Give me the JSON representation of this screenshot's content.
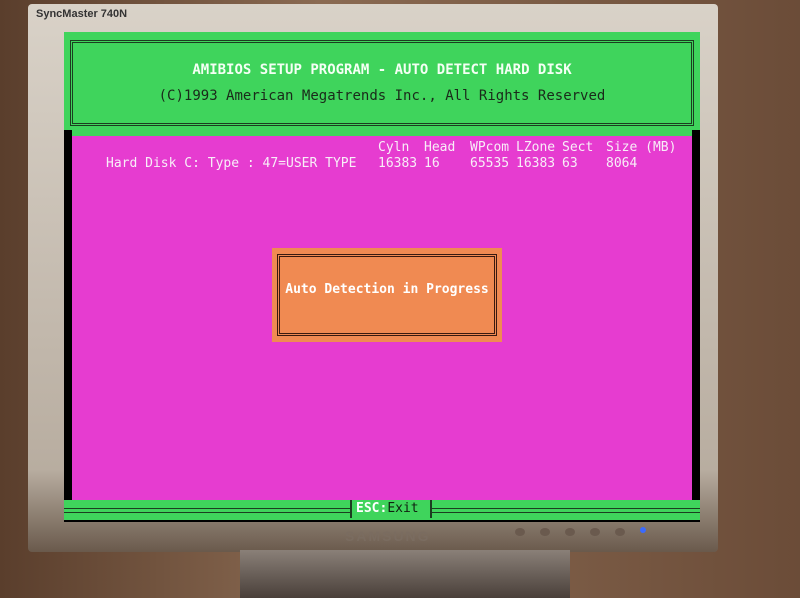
{
  "monitor": {
    "model": "SyncMaster 740N",
    "brand": "SAMSUNG"
  },
  "header": {
    "title": "AMIBIOS SETUP PROGRAM - AUTO DETECT HARD DISK",
    "copyright": "(C)1993 American Megatrends Inc., All Rights Reserved"
  },
  "disk": {
    "label": "Hard Disk C: Type : 47=USER TYPE",
    "columns": [
      "Cyln",
      "Head",
      "WPcom",
      "LZone",
      "Sect",
      "Size (MB)"
    ],
    "values": [
      "16383",
      "16",
      "65535",
      "16383",
      "63",
      "8064"
    ]
  },
  "dialog": {
    "message": "Auto Detection in Progress"
  },
  "footer": {
    "key": "ESC",
    "sep": ":",
    "action": "Exit"
  },
  "colors": {
    "header": "#3fd45c",
    "body": "#e63cd0",
    "dialog": "#f08a52"
  }
}
